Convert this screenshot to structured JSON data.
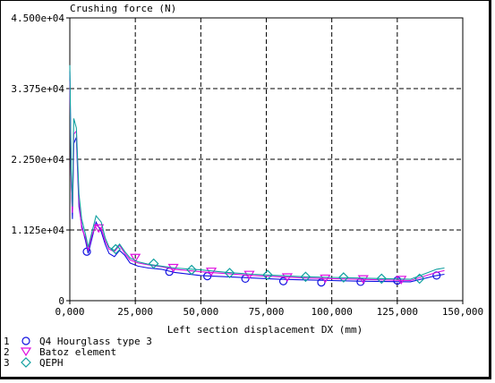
{
  "chart_data": {
    "type": "line",
    "ylabel": "Crushing force (N)",
    "xlabel": "Left section displacement DX (mm)",
    "xlim": [
      0,
      150000
    ],
    "ylim": [
      0,
      45000
    ],
    "x_ticks": [
      "0,000",
      "25,000",
      "50,000",
      "75,000",
      "100,000",
      "125,000",
      "150,000"
    ],
    "y_ticks": [
      "0",
      "1.125e+04",
      "2.250e+04",
      "3.375e+04",
      "4.500e+04"
    ],
    "grid": true,
    "legend_position": "bottom-left",
    "series": [
      {
        "id": "1",
        "name": "Q4 Hourglass type 3",
        "color": "#1010e0",
        "marker": "circle",
        "x": [
          0,
          500,
          1000,
          1500,
          2500,
          3500,
          4500,
          6000,
          7000,
          8500,
          10000,
          12000,
          13500,
          15000,
          17000,
          19000,
          21000,
          23000,
          26000,
          30000,
          35000,
          40000,
          50000,
          60000,
          70000,
          80000,
          90000,
          100000,
          110000,
          120000,
          130000,
          140000,
          143000
        ],
        "y": [
          36500,
          20000,
          13000,
          25000,
          26000,
          15000,
          12000,
          9500,
          7500,
          10000,
          12500,
          11000,
          9000,
          7500,
          7000,
          8000,
          7200,
          6000,
          5500,
          5200,
          5000,
          4500,
          4000,
          3800,
          3600,
          3400,
          3300,
          3200,
          3100,
          3050,
          3000,
          4000,
          4200
        ],
        "marker_x": [
          6500,
          38000,
          52500,
          67000,
          81500,
          96000,
          111000,
          125000,
          140000
        ],
        "marker_y": [
          7800,
          4600,
          3900,
          3500,
          3100,
          2900,
          3000,
          3200,
          4000
        ]
      },
      {
        "id": "2",
        "name": "Batoz element",
        "color": "#e010e0",
        "marker": "triangle-down",
        "x": [
          0,
          500,
          1000,
          1500,
          2500,
          3500,
          4500,
          6000,
          7000,
          8500,
          10000,
          12000,
          13500,
          15000,
          17000,
          19000,
          21000,
          23000,
          26000,
          30000,
          35000,
          40000,
          50000,
          60000,
          70000,
          80000,
          90000,
          100000,
          110000,
          120000,
          130000,
          140000,
          143000
        ],
        "y": [
          35000,
          19000,
          14000,
          26500,
          27000,
          16000,
          11500,
          10000,
          8000,
          10500,
          12000,
          11500,
          9500,
          8200,
          7800,
          8800,
          7500,
          6500,
          6000,
          5700,
          5400,
          5000,
          4600,
          4300,
          4000,
          3800,
          3600,
          3500,
          3400,
          3300,
          3200,
          4500,
          4800
        ],
        "marker_x": [
          11000,
          25000,
          39500,
          54000,
          68500,
          83000,
          97500,
          112000,
          126500
        ],
        "marker_y": [
          11500,
          6800,
          5200,
          4600,
          4100,
          3700,
          3500,
          3400,
          3300
        ]
      },
      {
        "id": "3",
        "name": "QEPH",
        "color": "#10a0a0",
        "marker": "diamond",
        "x": [
          0,
          500,
          1000,
          1500,
          2500,
          3500,
          4500,
          6000,
          7000,
          8500,
          10000,
          12000,
          13500,
          15000,
          17000,
          19000,
          21000,
          23000,
          26000,
          30000,
          35000,
          40000,
          50000,
          60000,
          70000,
          80000,
          90000,
          100000,
          110000,
          120000,
          130000,
          140000,
          143000
        ],
        "y": [
          37500,
          21000,
          15000,
          29000,
          27500,
          17000,
          13000,
          10500,
          8500,
          11000,
          13500,
          12500,
          10000,
          8500,
          8000,
          9000,
          7800,
          6800,
          6200,
          5800,
          5500,
          5200,
          4900,
          4500,
          4200,
          4000,
          3800,
          3700,
          3600,
          3500,
          3400,
          5000,
          5200
        ],
        "marker_x": [
          17500,
          32000,
          46500,
          61000,
          75500,
          90000,
          104500,
          119000,
          133500
        ],
        "marker_y": [
          8200,
          5900,
          4900,
          4400,
          4100,
          3800,
          3700,
          3500,
          3500
        ]
      }
    ]
  }
}
